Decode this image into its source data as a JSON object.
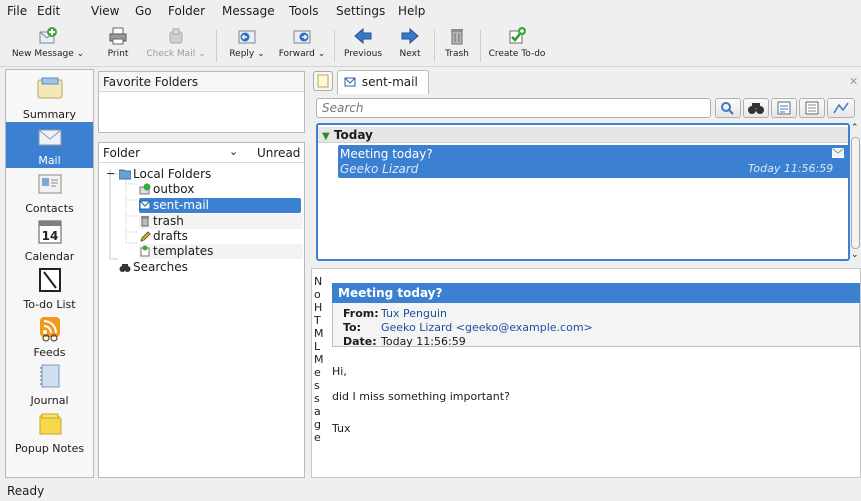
{
  "menu": [
    "File",
    "Edit",
    "View",
    "Go",
    "Folder",
    "Message",
    "Tools",
    "Settings",
    "Help"
  ],
  "toolbar": {
    "new_message": "New Message",
    "print": "Print",
    "check_mail": "Check Mail",
    "reply": "Reply",
    "forward": "Forward",
    "previous": "Previous",
    "next": "Next",
    "trash": "Trash",
    "create_todo": "Create To-do"
  },
  "sidebar": [
    "Summary",
    "Mail",
    "Contacts",
    "Calendar",
    "To-do List",
    "Feeds",
    "Journal",
    "Popup Notes"
  ],
  "calendar_day": "14",
  "favorites": {
    "title": "Favorite Folders"
  },
  "folders": {
    "col_folder": "Folder",
    "col_unread": "Unread",
    "local": "Local Folders",
    "items": [
      "outbox",
      "sent-mail",
      "trash",
      "drafts",
      "templates"
    ],
    "searches": "Searches"
  },
  "tab": {
    "label": "sent-mail"
  },
  "search": {
    "placeholder": "Search"
  },
  "list": {
    "group": "Today",
    "subject": "Meeting today?",
    "sender": "Geeko Lizard",
    "time": "Today 11:56:59"
  },
  "reader": {
    "side_text": "No HTML Message",
    "subject": "Meeting today?",
    "from_label": "From:",
    "from_value": "Tux Penguin",
    "to_label": "To:",
    "to_value": "Geeko Lizard <geeko@example.com>",
    "date_label": "Date:",
    "date_value": "Today 11:56:59",
    "body": [
      "Hi,",
      "did I miss something important?",
      "Tux"
    ]
  },
  "status": "Ready",
  "colors": {
    "accent": "#3c80d1",
    "link": "#1e4fa0"
  }
}
